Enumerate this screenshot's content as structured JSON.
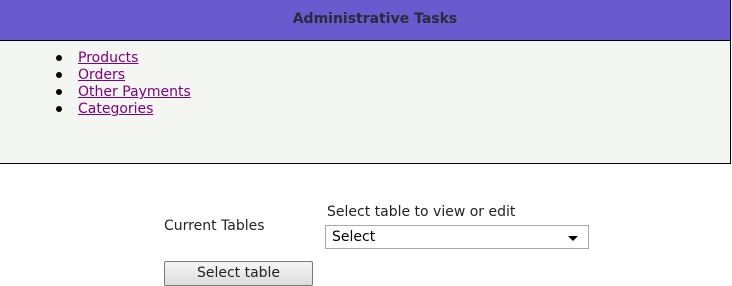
{
  "admin": {
    "title": "Administrative Tasks",
    "tasks": [
      {
        "label": "Products"
      },
      {
        "label": "Orders"
      },
      {
        "label": "Other Payments"
      },
      {
        "label": "Categories"
      }
    ]
  },
  "form": {
    "current_tables_label": "Current Tables",
    "select_caption": "Select table to view or edit",
    "select_value": "Select",
    "button_label": "Select table"
  },
  "colors": {
    "header_bg": "#6a5acd",
    "panel_bg": "#f4f6f1",
    "link": "#800080"
  }
}
